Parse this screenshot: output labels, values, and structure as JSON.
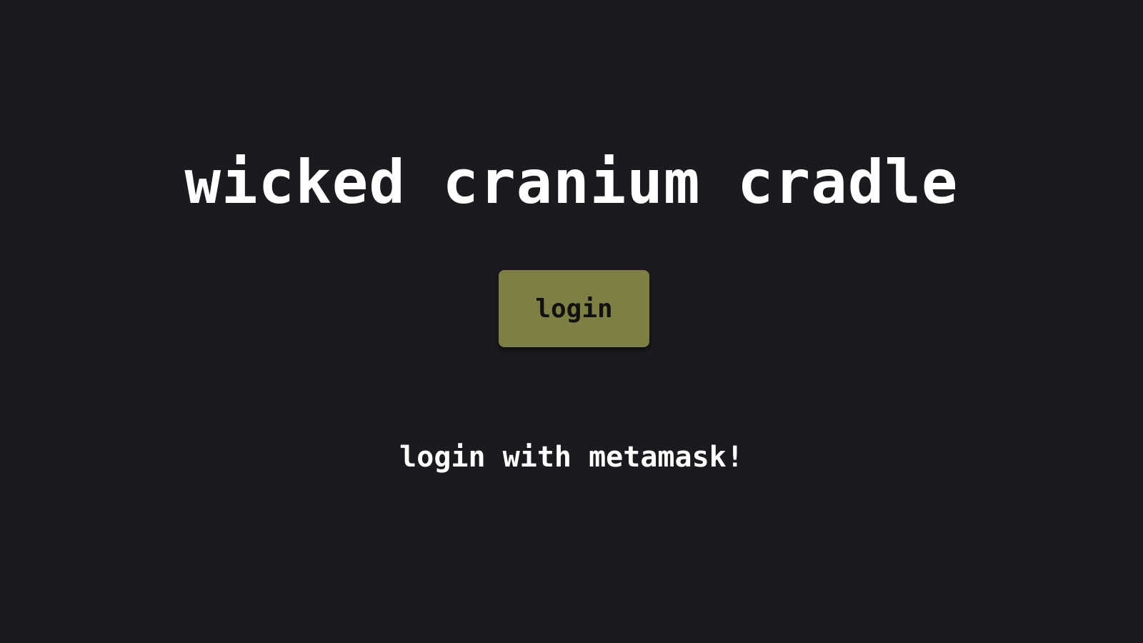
{
  "app": {
    "title": "wicked cranium cradle"
  },
  "actions": {
    "login_label": "login"
  },
  "hint": {
    "text": "login with metamask!"
  },
  "colors": {
    "background": "#1c1a1e",
    "button": "#7e7f42",
    "text": "#ffffff"
  }
}
